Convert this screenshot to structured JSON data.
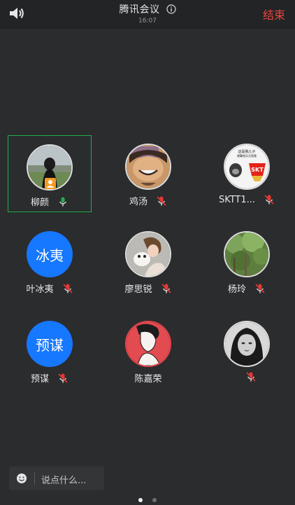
{
  "header": {
    "title": "腾讯会议",
    "time": "16:07",
    "end_label": "结束"
  },
  "participants": [
    {
      "name": "柳颜",
      "avatar": "photo-girl-outdoors",
      "mic": "active",
      "host": true,
      "selected": true
    },
    {
      "name": "鸡汤",
      "avatar": "cartoon-face",
      "mic": "muted"
    },
    {
      "name": "SKTT1...",
      "avatar": "meme-sticker",
      "mic": "muted",
      "avatar_text": "这是我儿子\n就算他天天找我\n去旺不旺我们一直尊\n重他",
      "logo_text": "SKT"
    },
    {
      "name": "叶冰夷",
      "avatar_text": "冰夷",
      "mic": "muted"
    },
    {
      "name": "廖思锐",
      "avatar": "photo-girl-dog",
      "mic": "muted"
    },
    {
      "name": "杨玲",
      "avatar": "photo-trees",
      "mic": "muted"
    },
    {
      "name": "预谋",
      "avatar_text": "预谋",
      "mic": "muted"
    },
    {
      "name": "陈嘉荣",
      "avatar": "illustration-profile",
      "mic": "none"
    },
    {
      "name": "",
      "avatar": "photo-woman-bw",
      "mic": "muted"
    }
  ],
  "chat": {
    "placeholder": "说点什么..."
  },
  "pagination": {
    "active_index": 0,
    "count": 2
  },
  "colors": {
    "accent_blue": "#1677ff",
    "end_red": "#e8453c",
    "active_green": "#1fae4b",
    "muted_red": "#e53935"
  }
}
